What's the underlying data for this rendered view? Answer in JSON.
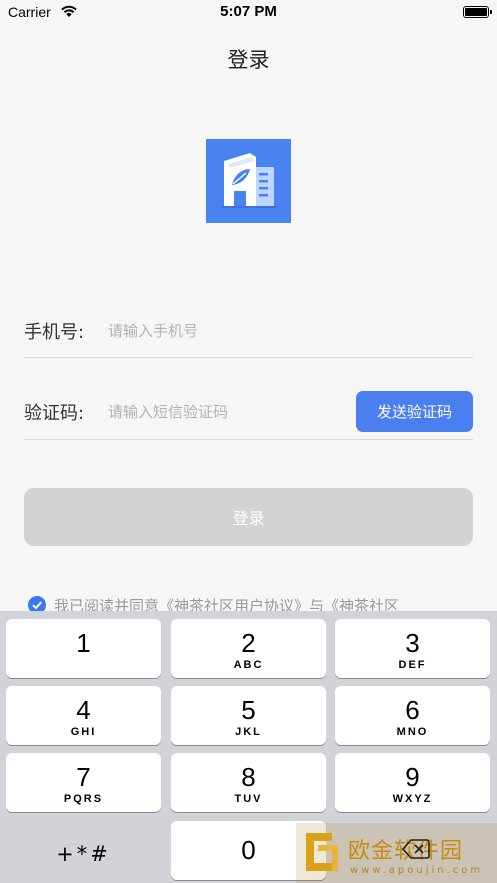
{
  "status_bar": {
    "carrier": "Carrier",
    "time": "5:07 PM"
  },
  "header": {
    "title": "登录"
  },
  "form": {
    "phone_label": "手机号:",
    "phone_placeholder": "请输入手机号",
    "code_label": "验证码:",
    "code_placeholder": "请输入短信验证码",
    "send_code_label": "发送验证码",
    "login_label": "登录"
  },
  "agreement": {
    "checked": true,
    "text": "我已阅读并同意《神茶社区用户协议》与《神茶社区"
  },
  "keyboard": {
    "keys": [
      {
        "digit": "1",
        "letters": ""
      },
      {
        "digit": "2",
        "letters": "ABC"
      },
      {
        "digit": "3",
        "letters": "DEF"
      },
      {
        "digit": "4",
        "letters": "GHI"
      },
      {
        "digit": "5",
        "letters": "JKL"
      },
      {
        "digit": "6",
        "letters": "MNO"
      },
      {
        "digit": "7",
        "letters": "PQRS"
      },
      {
        "digit": "8",
        "letters": "TUV"
      },
      {
        "digit": "9",
        "letters": "WXYZ"
      }
    ],
    "symbols": "+*#",
    "zero": "0"
  },
  "watermark": {
    "title": "欧金软件园",
    "subtitle": "www.apoujin.com"
  },
  "colors": {
    "accent": "#4a7ff0",
    "logo_bg": "#4a83f0",
    "disabled": "#d3d3d3",
    "watermark": "#c88a10"
  }
}
